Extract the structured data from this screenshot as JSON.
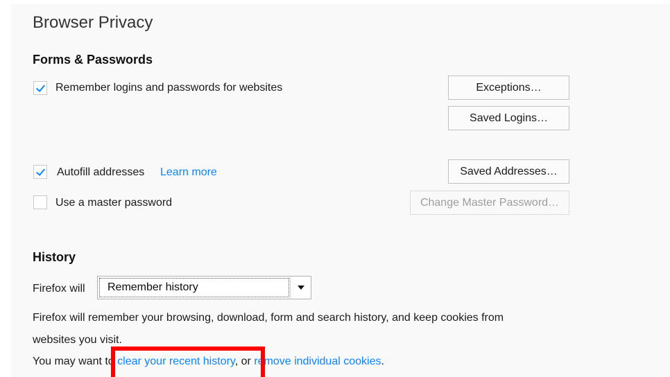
{
  "page": {
    "title": "Browser Privacy"
  },
  "forms": {
    "title": "Forms & Passwords",
    "remember_logins_label": "Remember logins and passwords for websites",
    "exceptions_button": "Exceptions…",
    "saved_logins_button": "Saved Logins…",
    "autofill_label": "Autofill addresses",
    "learn_more_link": "Learn more",
    "saved_addresses_button": "Saved Addresses…",
    "master_password_label": "Use a master password",
    "change_master_password_button": "Change Master Password…"
  },
  "history": {
    "title": "History",
    "firefox_will_label": "Firefox will",
    "mode_selected": "Remember history",
    "description_line1": "Firefox will remember your browsing, download, form and search history, and keep cookies from",
    "description_line2": "websites you visit.",
    "you_may_want": "You may want to ",
    "clear_history_link": "clear your recent history",
    "or_text": ", or ",
    "remove_cookies_link": "remove individual cookies",
    "period": "."
  },
  "colors": {
    "accent": "#0a84ff",
    "highlight": "#ff0000",
    "panel_background": "#f9f9fa"
  }
}
